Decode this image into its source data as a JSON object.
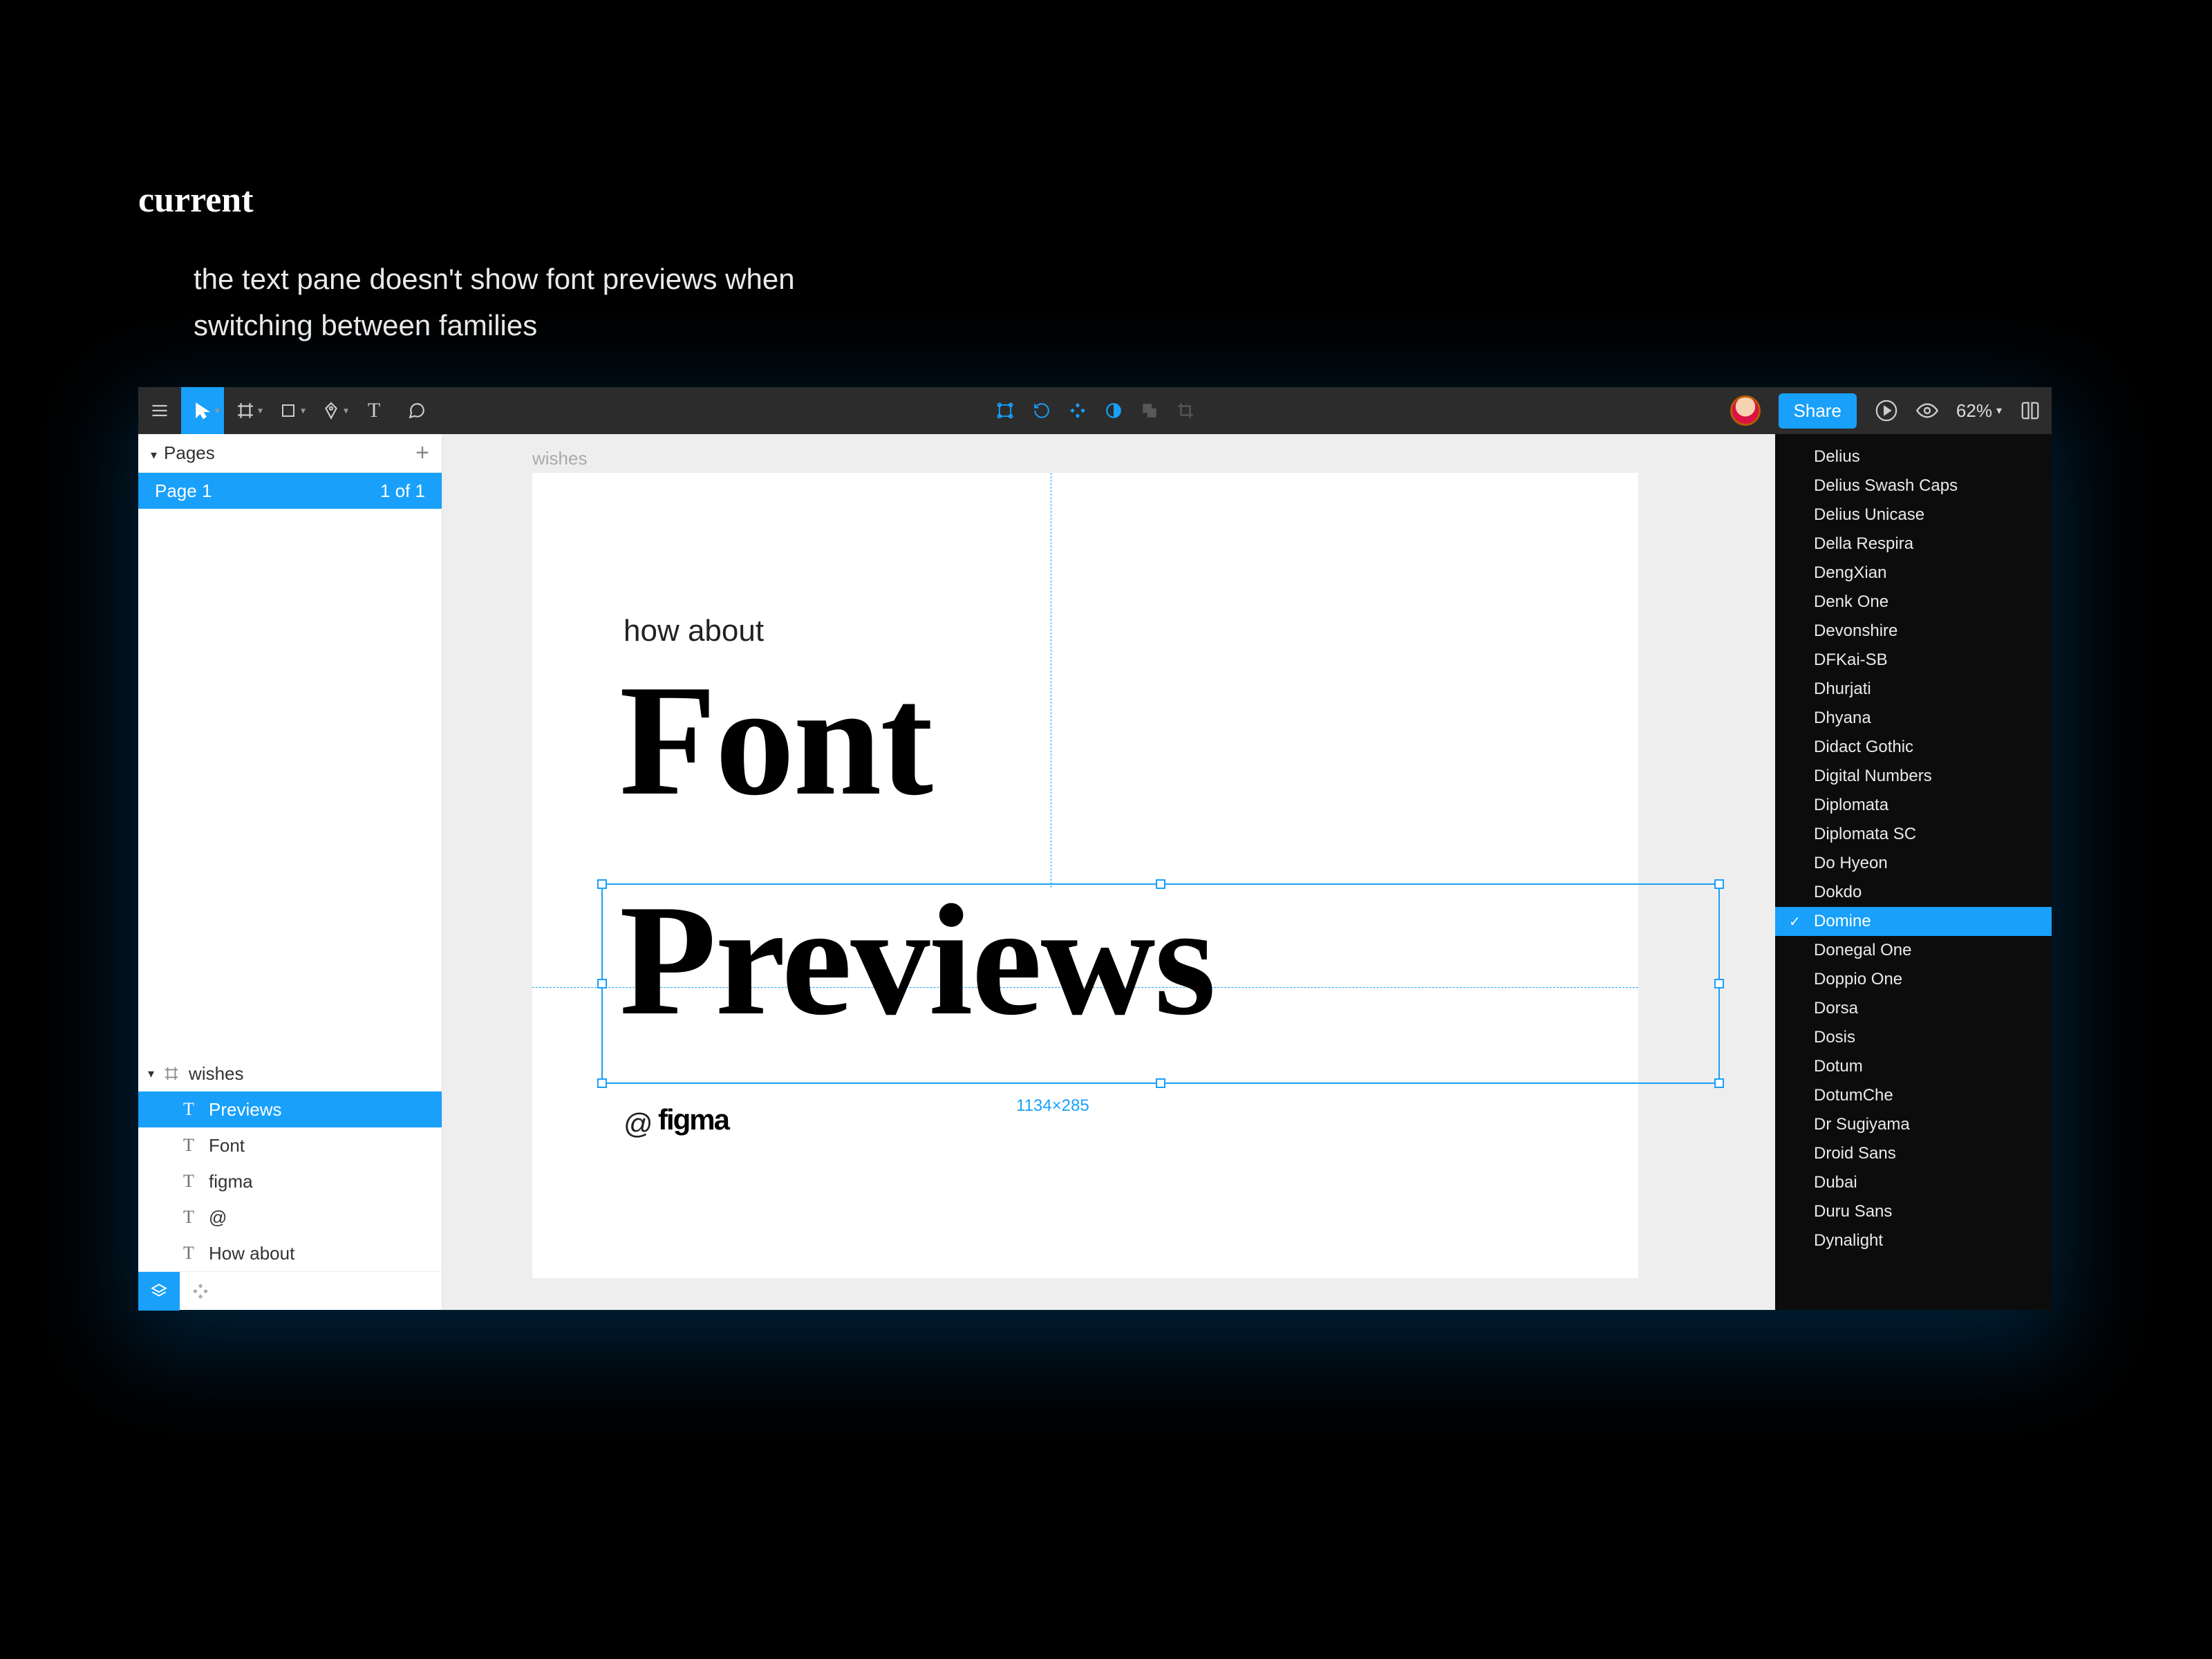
{
  "slide": {
    "title": "current",
    "desc": "the text pane doesn't show font previews when switching between families"
  },
  "toolbar": {
    "share": "Share",
    "zoom": "62%"
  },
  "pages_panel": {
    "header": "Pages",
    "page_name": "Page 1",
    "page_count": "1 of 1"
  },
  "layers": {
    "frame": "wishes",
    "items": [
      "Previews",
      "Font",
      "figma",
      "@",
      "How about"
    ],
    "selected_index": 0
  },
  "canvas": {
    "frame_label": "wishes",
    "text_howabout": "how about",
    "text_font": "Font",
    "text_previews": "Previews",
    "text_at": "@",
    "text_figma": "figma",
    "selection_dims": "1134×285"
  },
  "font_dropdown": {
    "selected": "Domine",
    "options": [
      "Delius",
      "Delius Swash Caps",
      "Delius Unicase",
      "Della Respira",
      "DengXian",
      "Denk One",
      "Devonshire",
      "DFKai-SB",
      "Dhurjati",
      "Dhyana",
      "Didact Gothic",
      "Digital Numbers",
      "Diplomata",
      "Diplomata SC",
      "Do Hyeon",
      "Dokdo",
      "Domine",
      "Donegal One",
      "Doppio One",
      "Dorsa",
      "Dosis",
      "Dotum",
      "DotumChe",
      "Dr Sugiyama",
      "Droid Sans",
      "Dubai",
      "Duru Sans",
      "Dynalight"
    ]
  }
}
